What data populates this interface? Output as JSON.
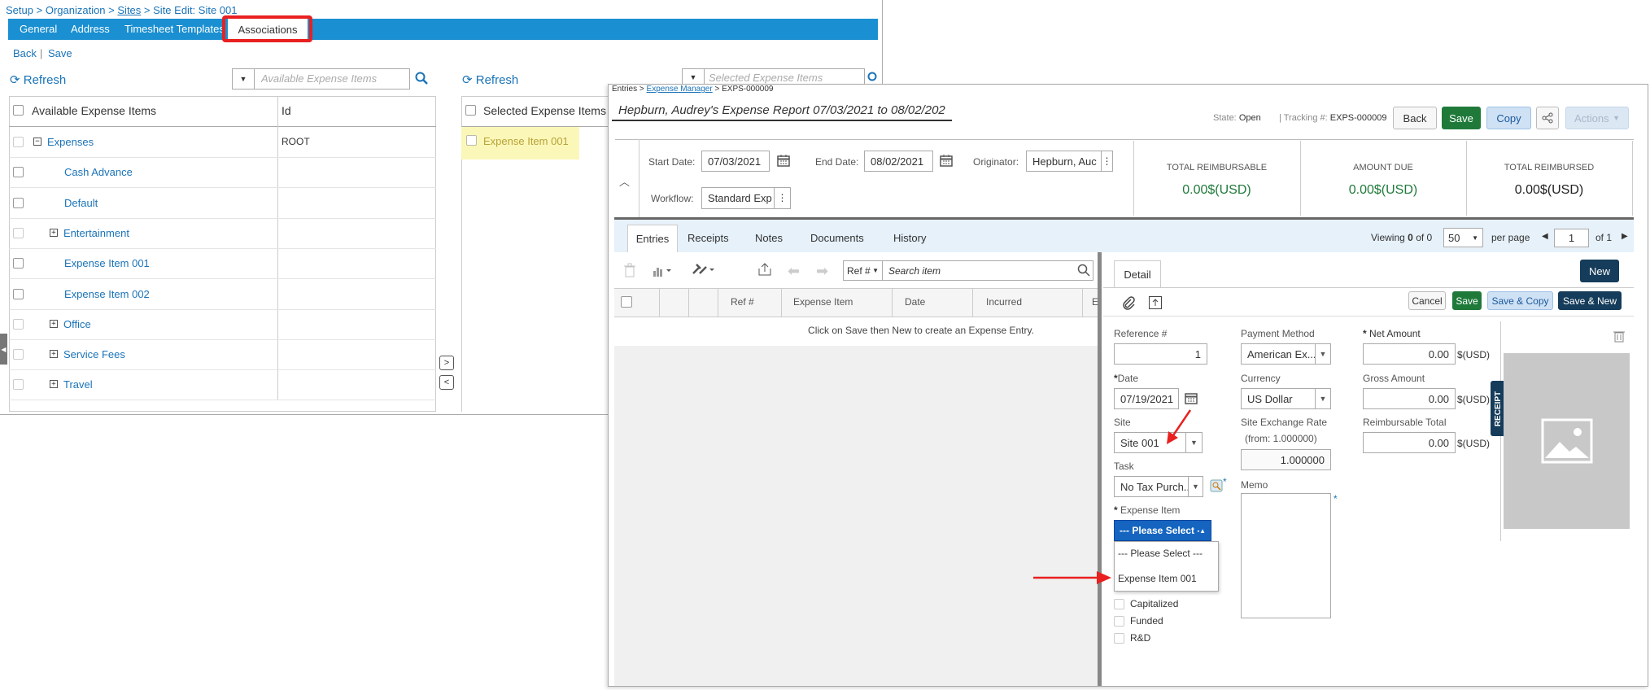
{
  "left": {
    "breadcrumb": {
      "part1": "Setup",
      "sep1": ">",
      "part2": "Organization",
      "sep2": ">",
      "part3": "Sites",
      "sep3": ">",
      "part4": "Site Edit: Site 001"
    },
    "tabs": [
      "General",
      "Address",
      "Timesheet Templates",
      "Associations"
    ],
    "back": "Back",
    "save": "Save",
    "sep": "|",
    "refresh": "Refresh",
    "avail_placeholder": "Available Expense Items",
    "sel_placeholder": "Selected Expense Items",
    "avail_header": "Available Expense Items",
    "id_header": "Id",
    "sel_header": "Selected Expense Items",
    "rows": [
      {
        "label": "Expenses",
        "id": "ROOT",
        "toggle": "−"
      },
      {
        "label": "Cash Advance",
        "id": ""
      },
      {
        "label": "Default",
        "id": ""
      },
      {
        "label": "Entertainment",
        "id": "",
        "toggle": "+"
      },
      {
        "label": "Expense Item 001",
        "id": ""
      },
      {
        "label": "Expense Item 002",
        "id": ""
      },
      {
        "label": "Office",
        "id": "",
        "toggle": "+"
      },
      {
        "label": "Service Fees",
        "id": "",
        "toggle": "+"
      },
      {
        "label": "Travel",
        "id": "",
        "toggle": "+"
      }
    ],
    "selected": [
      "Expense Item 001"
    ]
  },
  "right": {
    "breadcrumb": {
      "part1": "Entries",
      "sep1": ">",
      "part2": "Expense Manager",
      "sep2": ">",
      "part3": "EXPS-000009"
    },
    "title": "Hepburn, Audrey's Expense Report 07/03/2021 to 08/02/202",
    "state_label": "State:",
    "state_value": "Open",
    "tracking_label": "Tracking #:",
    "tracking_value": "EXPS-000009",
    "btn_back": "Back",
    "btn_save": "Save",
    "btn_copy": "Copy",
    "btn_actions": "Actions",
    "start_date_label": "Start Date:",
    "start_date": "07/03/2021",
    "end_date_label": "End Date:",
    "end_date": "08/02/2021",
    "originator_label": "Originator:",
    "originator": "Hepburn, Auc",
    "workflow_label": "Workflow:",
    "workflow": "Standard Exp",
    "summary": [
      {
        "label": "TOTAL REIMBURSABLE",
        "value": "0.00$(USD)"
      },
      {
        "label": "AMOUNT DUE",
        "value": "0.00$(USD)"
      },
      {
        "label": "TOTAL REIMBURSED",
        "value": "0.00$(USD)"
      }
    ],
    "tabs": [
      "Entries",
      "Receipts",
      "Notes",
      "Documents",
      "History"
    ],
    "viewing": {
      "prefix": "Viewing",
      "count": "0",
      "of_word": "of",
      "total": "0",
      "per_page_value": "50",
      "per_page_label": "per page",
      "page": "1",
      "of_pages": "of 1"
    },
    "search_field": "Ref #",
    "search_placeholder": "Search item",
    "grid_headers": [
      "Ref #",
      "Expense Item",
      "Date",
      "Incurred",
      "E"
    ],
    "empty_msg": "Click on Save then New to create an Expense Entry.",
    "detail": {
      "tab": "Detail",
      "btn_new": "New",
      "btn_cancel": "Cancel",
      "btn_save": "Save",
      "btn_save_copy": "Save & Copy",
      "btn_save_new": "Save & New",
      "ref_label": "Reference #",
      "ref_value": "1",
      "req": "*",
      "date_label": "Date",
      "date_value": "07/19/2021",
      "site_label": "Site",
      "site_value": "Site 001",
      "task_label": "Task",
      "task_value": "No Tax Purch...",
      "expense_item_label": "Expense Item",
      "expense_item_value": "--- Please Select -",
      "dropdown_options": [
        "--- Please Select ---",
        "Expense Item 001"
      ],
      "checkboxes": [
        "Capitalized",
        "Funded",
        "R&D"
      ],
      "payment_label": "Payment Method",
      "payment_value": "American Ex...",
      "currency_label": "Currency",
      "currency_value": "US Dollar",
      "ser_label": "Site Exchange Rate",
      "ser_from": "(from: 1.000000)",
      "ser_value": "1.000000",
      "memo_label": "Memo",
      "net_label": "Net Amount",
      "net_value": "0.00",
      "gross_label": "Gross Amount",
      "gross_value": "0.00",
      "reimb_label": "Reimbursable Total",
      "reimb_value": "0.00",
      "currency_unit": "$(USD)",
      "receipt_tab": "RECEIPT"
    }
  },
  "colors": {
    "accent": "#1a8fd1",
    "green": "#1f7a3a",
    "highlight": "#fbf7b8",
    "annotation": "#e82020"
  }
}
